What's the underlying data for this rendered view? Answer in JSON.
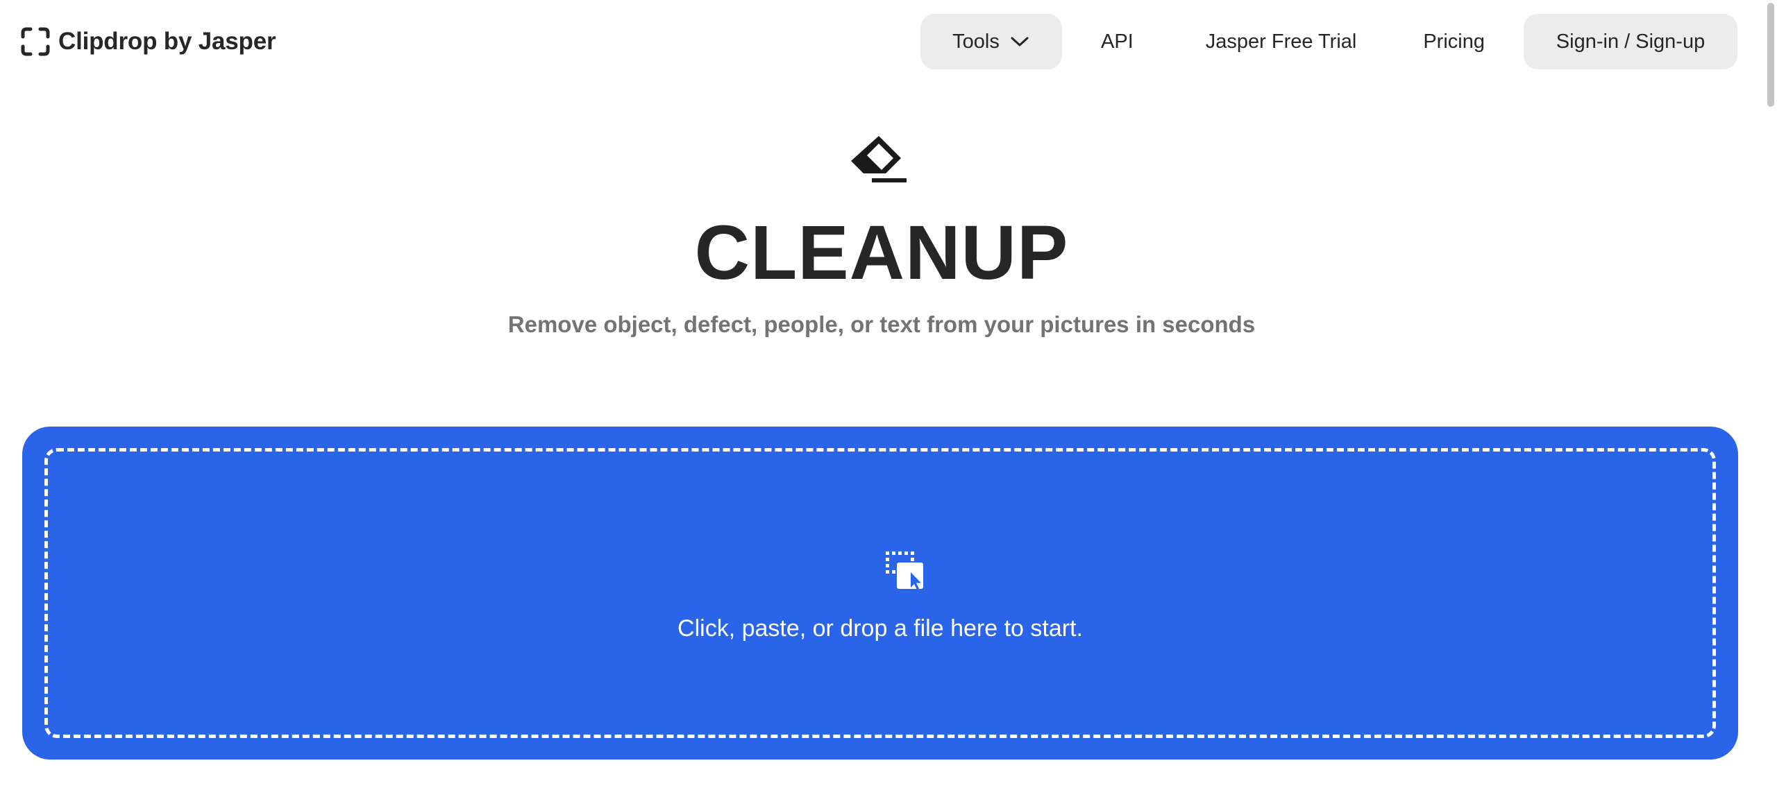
{
  "header": {
    "logo": {
      "brand": "Clipdrop",
      "suffix": "by Jasper",
      "icon": "clipdrop-logo-icon"
    },
    "nav": {
      "tools_label": "Tools",
      "tools_icon": "chevron-down-icon",
      "api_label": "API",
      "trial_label": "Jasper Free Trial",
      "pricing_label": "Pricing",
      "signin_label": "Sign-in / Sign-up"
    }
  },
  "hero": {
    "icon": "eraser-icon",
    "title": "CLEANUP",
    "subtitle": "Remove object, defect, people, or text from your pictures in seconds"
  },
  "dropzone": {
    "icon": "upload-file-icon",
    "text": "Click, paste, or drop a file here to start."
  },
  "colors": {
    "accent": "#2a64e9",
    "text": "#262626",
    "muted": "#737373",
    "pill": "#ececec"
  }
}
